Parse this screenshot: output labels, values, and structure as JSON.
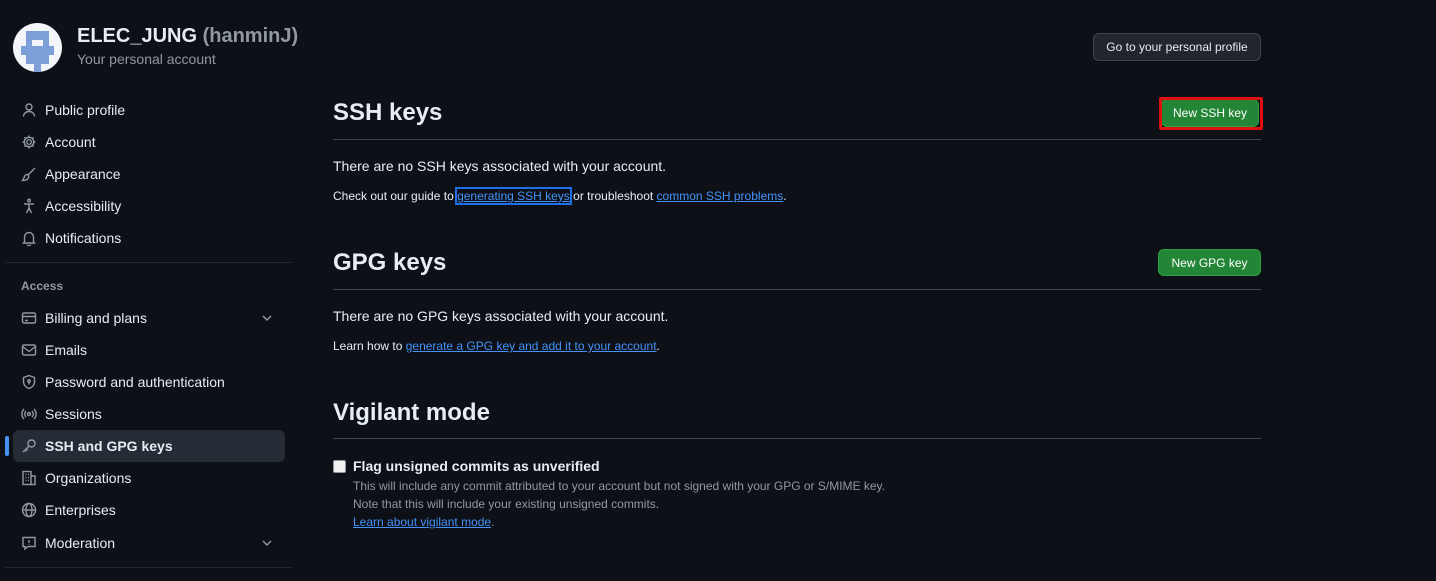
{
  "header": {
    "display_name": "ELEC_JUNG",
    "login": "(hanminJ)",
    "subtitle": "Your personal account",
    "profile_button": "Go to your personal profile"
  },
  "sidebar": {
    "items": [
      {
        "label": "Public profile",
        "icon": "person-icon"
      },
      {
        "label": "Account",
        "icon": "gear-icon"
      },
      {
        "label": "Appearance",
        "icon": "paintbrush-icon"
      },
      {
        "label": "Accessibility",
        "icon": "accessibility-icon"
      },
      {
        "label": "Notifications",
        "icon": "bell-icon"
      }
    ],
    "access_heading": "Access",
    "access_items": [
      {
        "label": "Billing and plans",
        "icon": "credit-card-icon"
      },
      {
        "label": "Emails",
        "icon": "mail-icon"
      },
      {
        "label": "Password and authentication",
        "icon": "shield-lock-icon"
      },
      {
        "label": "Sessions",
        "icon": "broadcast-icon"
      },
      {
        "label": "SSH and GPG keys",
        "icon": "key-icon",
        "active": true
      },
      {
        "label": "Organizations",
        "icon": "organization-icon"
      },
      {
        "label": "Enterprises",
        "icon": "globe-icon"
      },
      {
        "label": "Moderation",
        "icon": "report-icon"
      }
    ]
  },
  "ssh": {
    "title": "SSH keys",
    "new_button": "New SSH key",
    "empty_message": "There are no SSH keys associated with your account.",
    "hint_prefix": "Check out our guide to ",
    "hint_link1": "generating SSH keys",
    "hint_mid": " or troubleshoot ",
    "hint_link2": "common SSH problems",
    "hint_suffix": "."
  },
  "gpg": {
    "title": "GPG keys",
    "new_button": "New GPG key",
    "empty_message": "There are no GPG keys associated with your account.",
    "hint_prefix": "Learn how to ",
    "hint_link": "generate a GPG key and add it to your account",
    "hint_suffix": "."
  },
  "vigilant": {
    "title": "Vigilant mode",
    "checkbox_label": "Flag unsigned commits as unverified",
    "checked": false,
    "note_line1": "This will include any commit attributed to your account but not signed with your GPG or S/MIME key.",
    "note_line2": "Note that this will include your existing unsigned commits.",
    "learn_link": "Learn about vigilant mode",
    "learn_suffix": "."
  },
  "colors": {
    "background": "#0d1117",
    "accent": "#4493f8",
    "primary_button": "#238636",
    "highlight_box": "#e01010"
  }
}
